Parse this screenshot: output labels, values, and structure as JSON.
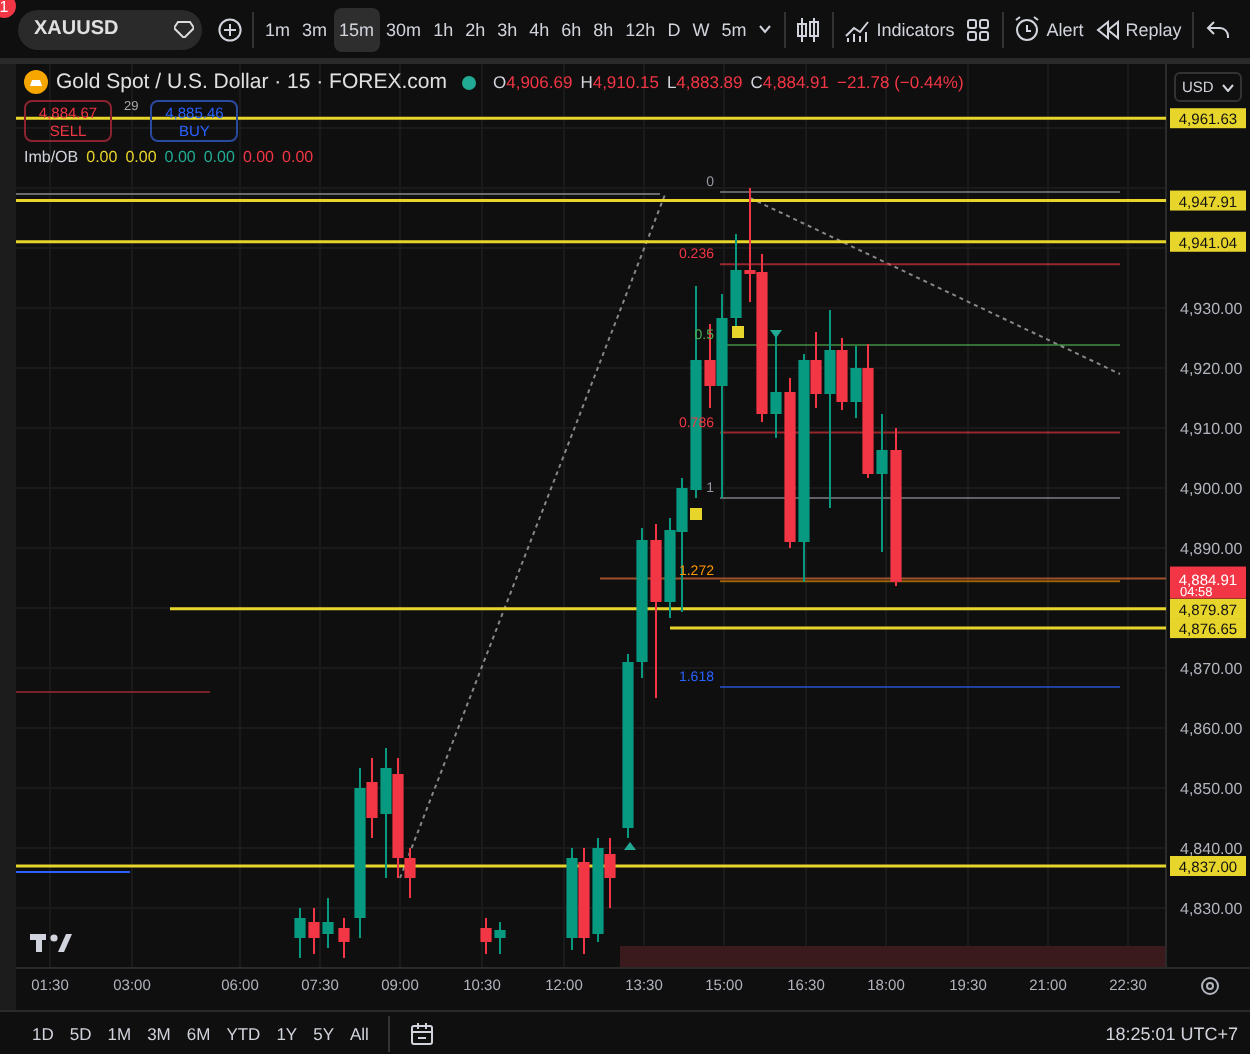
{
  "badge": "1",
  "toolbar": {
    "symbol": "XAUUSD",
    "intervals": [
      {
        "label": "1m",
        "selected": false
      },
      {
        "label": "3m",
        "selected": false
      },
      {
        "label": "15m",
        "selected": true
      },
      {
        "label": "30m",
        "selected": false
      },
      {
        "label": "1h",
        "selected": false
      },
      {
        "label": "2h",
        "selected": false
      },
      {
        "label": "3h",
        "selected": false
      },
      {
        "label": "4h",
        "selected": false
      },
      {
        "label": "6h",
        "selected": false
      },
      {
        "label": "8h",
        "selected": false
      },
      {
        "label": "12h",
        "selected": false
      },
      {
        "label": "D",
        "selected": false
      },
      {
        "label": "W",
        "selected": false
      },
      {
        "label": "5m",
        "selected": false
      }
    ],
    "indicators": "Indicators",
    "alert": "Alert",
    "replay": "Replay"
  },
  "legend": {
    "title": "Gold Spot / U.S. Dollar · 15 · FOREX.com",
    "market_open": true,
    "ohlc": [
      {
        "key": "O",
        "value": "4,906.69"
      },
      {
        "key": "H",
        "value": "4,910.15"
      },
      {
        "key": "L",
        "value": "4,883.89"
      },
      {
        "key": "C",
        "value": "4,884.91"
      }
    ],
    "change": "−21.78 (−0.44%)",
    "currency": "USD"
  },
  "trade": {
    "sell_price": "4,884.67",
    "sell_label": "SELL",
    "spread": "29",
    "buy_price": "4,885.46",
    "buy_label": "BUY"
  },
  "indicator": {
    "name": "Imb/OB",
    "values": [
      {
        "text": "0.00",
        "color": "#e8d52c"
      },
      {
        "text": "0.00",
        "color": "#e8d52c"
      },
      {
        "text": "0.00",
        "color": "#22ab94"
      },
      {
        "text": "0.00",
        "color": "#22ab94"
      },
      {
        "text": "0.00",
        "color": "#f23645"
      },
      {
        "text": "0.00",
        "color": "#f23645"
      }
    ]
  },
  "price_axis": [
    "4,930.00",
    "4,920.00",
    "4,910.00",
    "4,900.00",
    "4,890.00",
    "4,870.00",
    "4,860.00",
    "4,850.00",
    "4,840.00",
    "4,830.00"
  ],
  "price_lines": [
    {
      "label": "4,961.63"
    },
    {
      "label": "4,947.91"
    },
    {
      "label": "4,941.04"
    },
    {
      "label": "4,879.87"
    },
    {
      "label": "4,876.65"
    },
    {
      "label": "4,837.00"
    }
  ],
  "last_price": {
    "value": "4,884.91",
    "countdown": "04:58"
  },
  "fib_levels": [
    {
      "label": "0",
      "color": "#9598a1"
    },
    {
      "label": "0.236",
      "color": "#f23645"
    },
    {
      "label": "0.5",
      "color": "#4caf50"
    },
    {
      "label": "0.786",
      "color": "#f23645"
    },
    {
      "label": "1",
      "color": "#9598a1"
    },
    {
      "label": "1.272",
      "color": "#ff9800"
    },
    {
      "label": "1.618",
      "color": "#2962ff"
    }
  ],
  "time_axis": [
    "01:30",
    "03:00",
    "06:00",
    "07:30",
    "09:00",
    "10:30",
    "12:00",
    "13:30",
    "15:00",
    "16:30",
    "18:00",
    "19:30",
    "21:00",
    "22:30"
  ],
  "ranges": [
    "1D",
    "5D",
    "1M",
    "3M",
    "6M",
    "YTD",
    "1Y",
    "5Y",
    "All"
  ],
  "clock": "18:25:01 UTC+7"
}
